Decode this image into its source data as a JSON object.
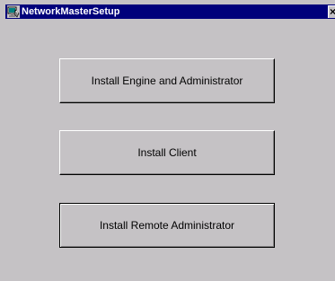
{
  "window": {
    "title": "NetworkMasterSetup",
    "app_icon": "setup-app-icon",
    "close_glyph": "×"
  },
  "buttons": {
    "install_engine_admin": "Install Engine and Administrator",
    "install_client": "Install Client",
    "install_remote_admin": "Install Remote Administrator"
  },
  "colors": {
    "titlebar": "#00007b",
    "face": "#c5c2c5",
    "title_text": "#ffffff"
  }
}
